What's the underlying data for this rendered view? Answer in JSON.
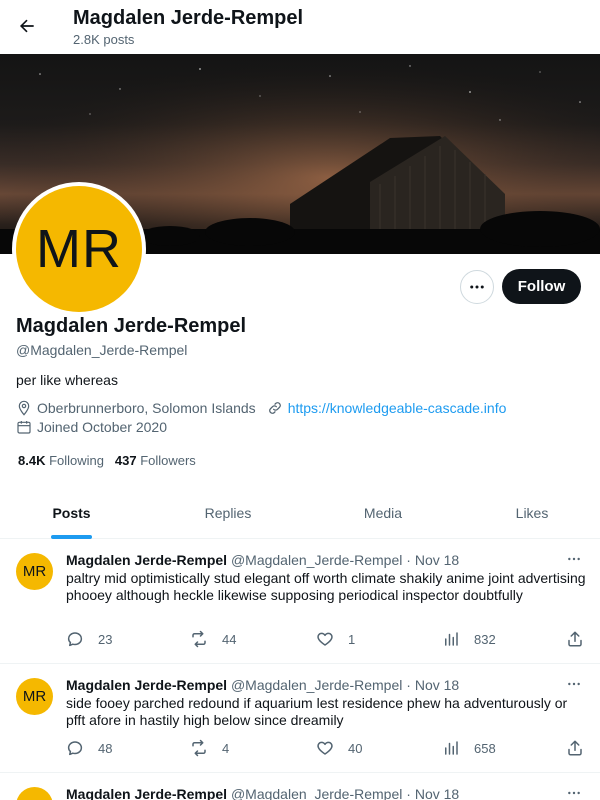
{
  "header": {
    "title": "Magdalen Jerde-Rempel",
    "post_count": "2.8K posts"
  },
  "profile": {
    "avatar_initials": "MR",
    "name": "Magdalen Jerde-Rempel",
    "handle": "@Magdalen_Jerde-Rempel",
    "bio": "per like whereas",
    "location": "Oberbrunnerboro, Solomon Islands",
    "website": "https://knowledgeable-cascade.info",
    "joined": "Joined October 2020",
    "following_count": "8.4K",
    "following_label": "Following",
    "followers_count": "437",
    "followers_label": "Followers",
    "follow_label": "Follow"
  },
  "tabs": [
    {
      "label": "Posts"
    },
    {
      "label": "Replies"
    },
    {
      "label": "Media"
    },
    {
      "label": "Likes"
    }
  ],
  "posts": [
    {
      "avatar": "MR",
      "name": "Magdalen Jerde-Rempel",
      "handle": "@Magdalen_Jerde-Rempel",
      "sep": "·",
      "date": "Nov 18",
      "text": "paltry mid optimistically stud elegant off worth climate shakily anime joint advertising phooey although heckle likewise supposing periodical inspector doubtfully",
      "replies": "23",
      "reposts": "44",
      "likes": "1",
      "views": "832"
    },
    {
      "avatar": "MR",
      "name": "Magdalen Jerde-Rempel",
      "handle": "@Magdalen_Jerde-Rempel",
      "sep": "·",
      "date": "Nov 18",
      "text": "side fooey parched redound if aquarium lest residence phew ha adventurously or pfft afore in hastily high below since dreamily",
      "replies": "48",
      "reposts": "4",
      "likes": "40",
      "views": "658"
    },
    {
      "avatar": "MR",
      "name": "Magdalen Jerde-Rempel",
      "handle": "@Magdalen_Jerde-Rempel",
      "sep": "·",
      "date": "Nov 18",
      "text": ""
    }
  ],
  "colors": {
    "accent": "#1d9bf0",
    "avatar_bg": "#f5b800",
    "text_primary": "#0f1419",
    "text_secondary": "#536471"
  }
}
